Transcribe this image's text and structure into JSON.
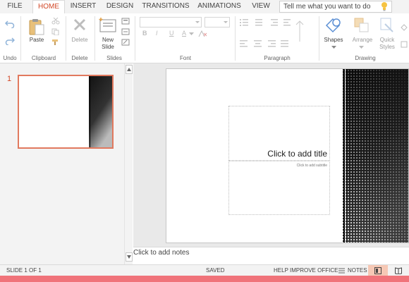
{
  "tabs": [
    "FILE",
    "HOME",
    "INSERT",
    "DESIGN",
    "TRANSITIONS",
    "ANIMATIONS",
    "VIEW"
  ],
  "active_tab": "HOME",
  "tell_me": {
    "placeholder": "Tell me what you want to do"
  },
  "ribbon": {
    "undo": {
      "group_label": "Undo"
    },
    "clipboard": {
      "paste_label": "Paste",
      "group_label": "Clipboard"
    },
    "delete": {
      "delete_label": "Delete",
      "group_label": "Delete"
    },
    "slides": {
      "new_slide_label_1": "New",
      "new_slide_label_2": "Slide",
      "group_label": "Slides"
    },
    "font": {
      "group_label": "Font",
      "bold": "B",
      "italic": "I",
      "underline": "U",
      "font_color": "A"
    },
    "paragraph": {
      "group_label": "Paragraph"
    },
    "drawing": {
      "shapes_label": "Shapes",
      "arrange_label": "Arrange",
      "quick_styles_label_1": "Quick",
      "quick_styles_label_2": "Styles",
      "group_label": "Drawing"
    }
  },
  "thumbnail_pane": {
    "slide_number": "1"
  },
  "slide": {
    "title_placeholder": "Click to add title",
    "subtitle_placeholder": "Click to add subtitle"
  },
  "notes": {
    "placeholder": "Click to add notes"
  },
  "status": {
    "slide_info": "SLIDE 1 OF 1",
    "saved": "SAVED",
    "help_improve": "HELP IMPROVE OFFICE",
    "notes_button": "NOTES"
  },
  "colors": {
    "accent": "#d24726",
    "thumb_border": "#e1795e",
    "bottom_bar": "#f0737a"
  }
}
